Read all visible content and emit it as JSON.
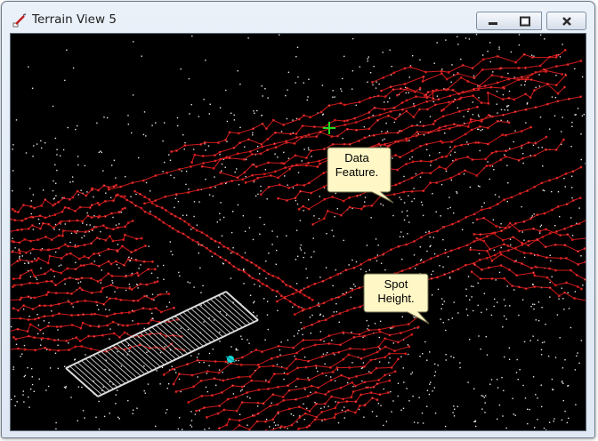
{
  "window": {
    "title": "Terrain View 5",
    "icon": "terrain-pen-icon",
    "controls": {
      "minimize": "minimize-icon",
      "maximize": "maximize-icon",
      "close": "close-icon"
    }
  },
  "viewport": {
    "background": "#000000",
    "contour_color": "#d01a1a",
    "point_color": "#e6e6e6",
    "cursor_color": "#22dd22",
    "callouts": [
      {
        "id": "data-feature",
        "line1": "Data",
        "line2": "Feature."
      },
      {
        "id": "spot-height",
        "line1": "Spot",
        "line2": "Height."
      }
    ]
  }
}
